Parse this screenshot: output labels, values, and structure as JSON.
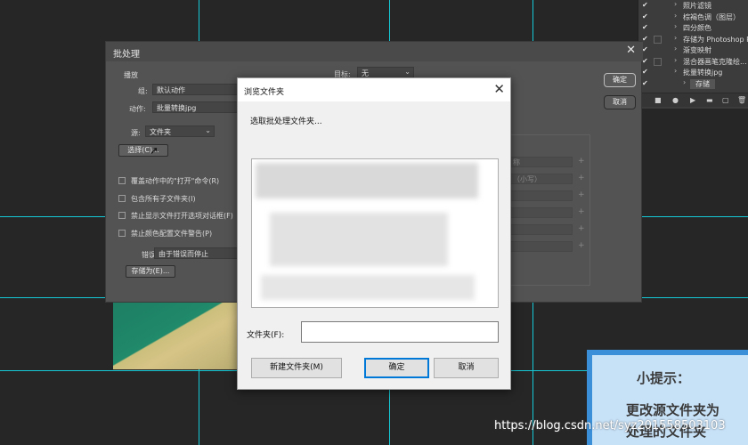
{
  "actions_panel": {
    "items": [
      {
        "label": "照片滤镜",
        "checked": true,
        "has_box": false,
        "selected": false,
        "indent": 1
      },
      {
        "label": "棕褐色调（图层）",
        "checked": true,
        "has_box": false,
        "selected": false,
        "indent": 1
      },
      {
        "label": "四分颜色",
        "checked": true,
        "has_box": false,
        "selected": false,
        "indent": 1
      },
      {
        "label": "存储为 Photoshop P...",
        "checked": true,
        "has_box": true,
        "selected": false,
        "indent": 1
      },
      {
        "label": "渐变映射",
        "checked": true,
        "has_box": false,
        "selected": false,
        "indent": 1
      },
      {
        "label": "混合器画笔克隆绘...",
        "checked": true,
        "has_box": true,
        "selected": false,
        "indent": 1
      },
      {
        "label": "批量转换jpg",
        "checked": true,
        "has_box": false,
        "selected": false,
        "indent": 1
      },
      {
        "label": "存储",
        "checked": true,
        "has_box": false,
        "selected": true,
        "indent": 2
      }
    ],
    "toolbar_icons": [
      "stop-icon",
      "record-icon",
      "play-icon",
      "folder-icon",
      "new-action-icon",
      "trash-icon"
    ]
  },
  "batch_dialog": {
    "title": "批处理",
    "play_label": "播放",
    "set_label": "组:",
    "set_value": "默认动作",
    "action_label": "动作:",
    "action_value": "批量转换jpg",
    "source_label": "源:",
    "source_value": "文件夹",
    "choose_label": "选择(C)...",
    "options": [
      {
        "label": "覆盖动作中的\"打开\"命令(R)"
      },
      {
        "label": "包含所有子文件夹(I)"
      },
      {
        "label": "禁止显示文件打开选项对话框(F)"
      },
      {
        "label": "禁止颜色配置文件警告(P)"
      }
    ],
    "errors_label": "错误:",
    "errors_value": "由于错误而停止",
    "save_as_label": "存储为(E)...",
    "dest_label": "目标:",
    "dest_value": "无",
    "ok_label": "确定",
    "cancel_label": "取消",
    "right_fields": [
      "称",
      "（小写）",
      "",
      "",
      "",
      ""
    ]
  },
  "browse_dialog": {
    "title": "浏览文件夹",
    "prompt": "选取批处理文件夹...",
    "folder_label": "文件夹(F):",
    "folder_value": "",
    "new_folder_label": "新建文件夹(M)",
    "ok_label": "确定",
    "cancel_label": "取消"
  },
  "hint": {
    "title": "小提示：",
    "line1": "更改源文件夹为",
    "line2": "处理的文件夹"
  },
  "watermark": "https://blog.csdn.net/syz201558503103"
}
